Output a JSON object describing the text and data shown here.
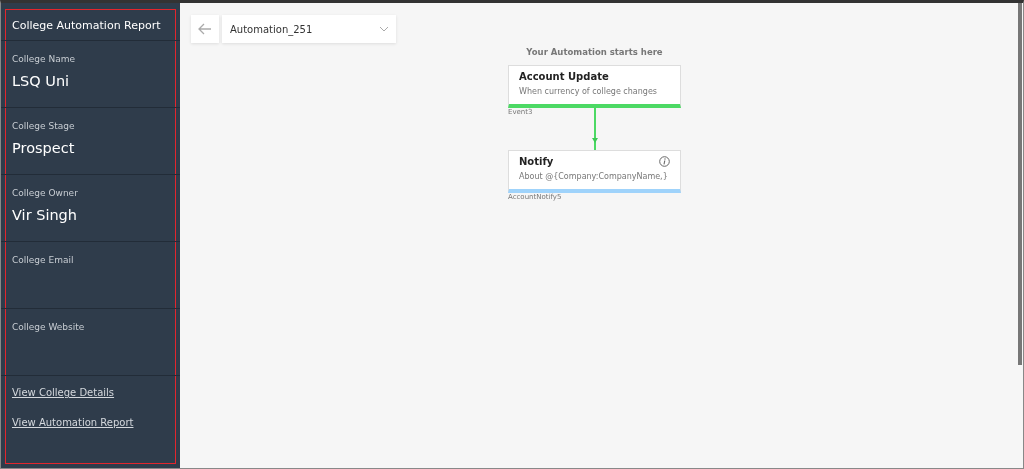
{
  "sidebar": {
    "title": "College Automation Report",
    "highlighted": true,
    "fields": [
      {
        "label": "College Name",
        "value": "LSQ Uni"
      },
      {
        "label": "College Stage",
        "value": "Prospect"
      },
      {
        "label": "College Owner",
        "value": "Vir Singh"
      },
      {
        "label": "College Email"
      },
      {
        "label": "College Website"
      }
    ],
    "links": [
      "View College Details",
      "View Automation Report"
    ]
  },
  "toolbar": {
    "automation_select": "Automation_251"
  },
  "flow": {
    "start_label": "Your Automation starts here",
    "nodes": [
      {
        "title": "Account Update",
        "description": "When currency of college changes",
        "id_label": "Event3",
        "color": "#4cd964"
      },
      {
        "title": "Notify",
        "description": "About @{Company:CompanyName,}",
        "id_label": "AccountNotify5",
        "color": "#9fd3fb",
        "info": true
      }
    ]
  }
}
